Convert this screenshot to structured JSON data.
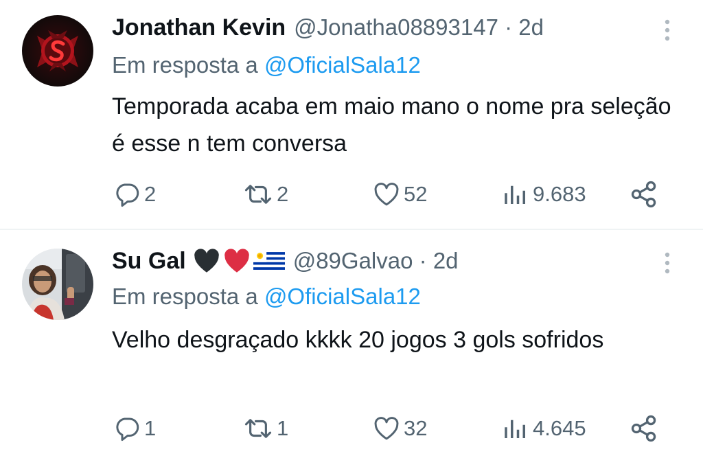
{
  "tweets": [
    {
      "display_name": "Jonathan Kevin",
      "handle": "@Jonatha08893147",
      "separator": "·",
      "time": "2d",
      "reply_prefix": "Em resposta a",
      "reply_mention": "@OficialSala12",
      "text": "Temporada acaba em maio mano o nome pra seleção é esse n tem conversa",
      "emojis": [],
      "stats": {
        "replies": "2",
        "retweets": "2",
        "likes": "52",
        "views": "9.683"
      }
    },
    {
      "display_name": "Su Gal",
      "handle": "@89Galvao",
      "separator": "·",
      "time": "2d",
      "reply_prefix": "Em resposta a",
      "reply_mention": "@OficialSala12",
      "text": "Velho desgraçado kkkk 20 jogos 3 gols sofridos",
      "emojis": [
        "black-heart",
        "red-heart",
        "uruguay-flag"
      ],
      "stats": {
        "replies": "1",
        "retweets": "1",
        "likes": "32",
        "views": "4.645"
      }
    }
  ],
  "colors": {
    "text_primary": "#0f1419",
    "text_secondary": "#536471",
    "link": "#1d9bf0",
    "divider": "#eff3f4"
  },
  "icons": {
    "reply": "reply-icon",
    "retweet": "retweet-icon",
    "like": "heart-icon",
    "views": "views-icon",
    "share": "share-icon",
    "more": "more-vertical-icon"
  }
}
